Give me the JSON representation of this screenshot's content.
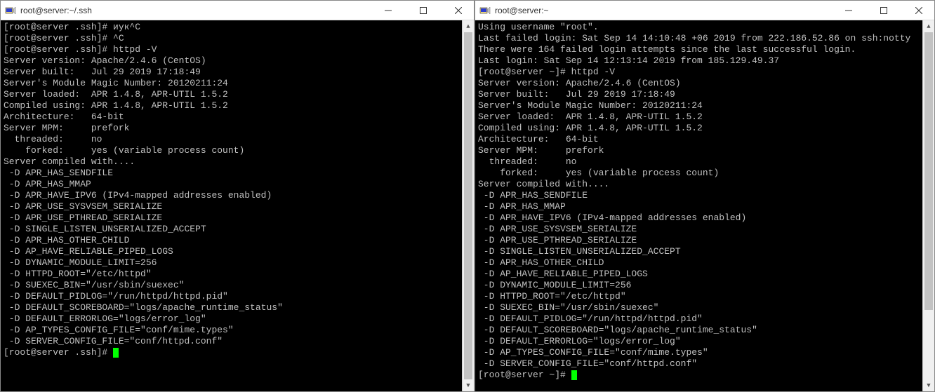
{
  "left": {
    "title": "root@server:~/.ssh",
    "lines": [
      "[root@server .ssh]# иук^C",
      "[root@server .ssh]# ^C",
      "[root@server .ssh]# httpd -V",
      "Server version: Apache/2.4.6 (CentOS)",
      "Server built:   Jul 29 2019 17:18:49",
      "Server's Module Magic Number: 20120211:24",
      "Server loaded:  APR 1.4.8, APR-UTIL 1.5.2",
      "Compiled using: APR 1.4.8, APR-UTIL 1.5.2",
      "Architecture:   64-bit",
      "Server MPM:     prefork",
      "  threaded:     no",
      "    forked:     yes (variable process count)",
      "Server compiled with....",
      " -D APR_HAS_SENDFILE",
      " -D APR_HAS_MMAP",
      " -D APR_HAVE_IPV6 (IPv4-mapped addresses enabled)",
      " -D APR_USE_SYSVSEM_SERIALIZE",
      " -D APR_USE_PTHREAD_SERIALIZE",
      " -D SINGLE_LISTEN_UNSERIALIZED_ACCEPT",
      " -D APR_HAS_OTHER_CHILD",
      " -D AP_HAVE_RELIABLE_PIPED_LOGS",
      " -D DYNAMIC_MODULE_LIMIT=256",
      " -D HTTPD_ROOT=\"/etc/httpd\"",
      " -D SUEXEC_BIN=\"/usr/sbin/suexec\"",
      " -D DEFAULT_PIDLOG=\"/run/httpd/httpd.pid\"",
      " -D DEFAULT_SCOREBOARD=\"logs/apache_runtime_status\"",
      " -D DEFAULT_ERRORLOG=\"logs/error_log\"",
      " -D AP_TYPES_CONFIG_FILE=\"conf/mime.types\"",
      " -D SERVER_CONFIG_FILE=\"conf/httpd.conf\""
    ],
    "prompt": "[root@server .ssh]# "
  },
  "right": {
    "title": "root@server:~",
    "lines": [
      "Using username \"root\".",
      "Last failed login: Sat Sep 14 14:10:48 +06 2019 from 222.186.52.86 on ssh:notty",
      "There were 164 failed login attempts since the last successful login.",
      "Last login: Sat Sep 14 12:13:14 2019 from 185.129.49.37",
      "[root@server ~]# httpd -V",
      "Server version: Apache/2.4.6 (CentOS)",
      "Server built:   Jul 29 2019 17:18:49",
      "Server's Module Magic Number: 20120211:24",
      "Server loaded:  APR 1.4.8, APR-UTIL 1.5.2",
      "Compiled using: APR 1.4.8, APR-UTIL 1.5.2",
      "Architecture:   64-bit",
      "Server MPM:     prefork",
      "  threaded:     no",
      "    forked:     yes (variable process count)",
      "Server compiled with....",
      " -D APR_HAS_SENDFILE",
      " -D APR_HAS_MMAP",
      " -D APR_HAVE_IPV6 (IPv4-mapped addresses enabled)",
      " -D APR_USE_SYSVSEM_SERIALIZE",
      " -D APR_USE_PTHREAD_SERIALIZE",
      " -D SINGLE_LISTEN_UNSERIALIZED_ACCEPT",
      " -D APR_HAS_OTHER_CHILD",
      " -D AP_HAVE_RELIABLE_PIPED_LOGS",
      " -D DYNAMIC_MODULE_LIMIT=256",
      " -D HTTPD_ROOT=\"/etc/httpd\"",
      " -D SUEXEC_BIN=\"/usr/sbin/suexec\"",
      " -D DEFAULT_PIDLOG=\"/run/httpd/httpd.pid\"",
      " -D DEFAULT_SCOREBOARD=\"logs/apache_runtime_status\"",
      " -D DEFAULT_ERRORLOG=\"logs/error_log\"",
      " -D AP_TYPES_CONFIG_FILE=\"conf/mime.types\"",
      " -D SERVER_CONFIG_FILE=\"conf/httpd.conf\""
    ],
    "prompt": "[root@server ~]# "
  }
}
